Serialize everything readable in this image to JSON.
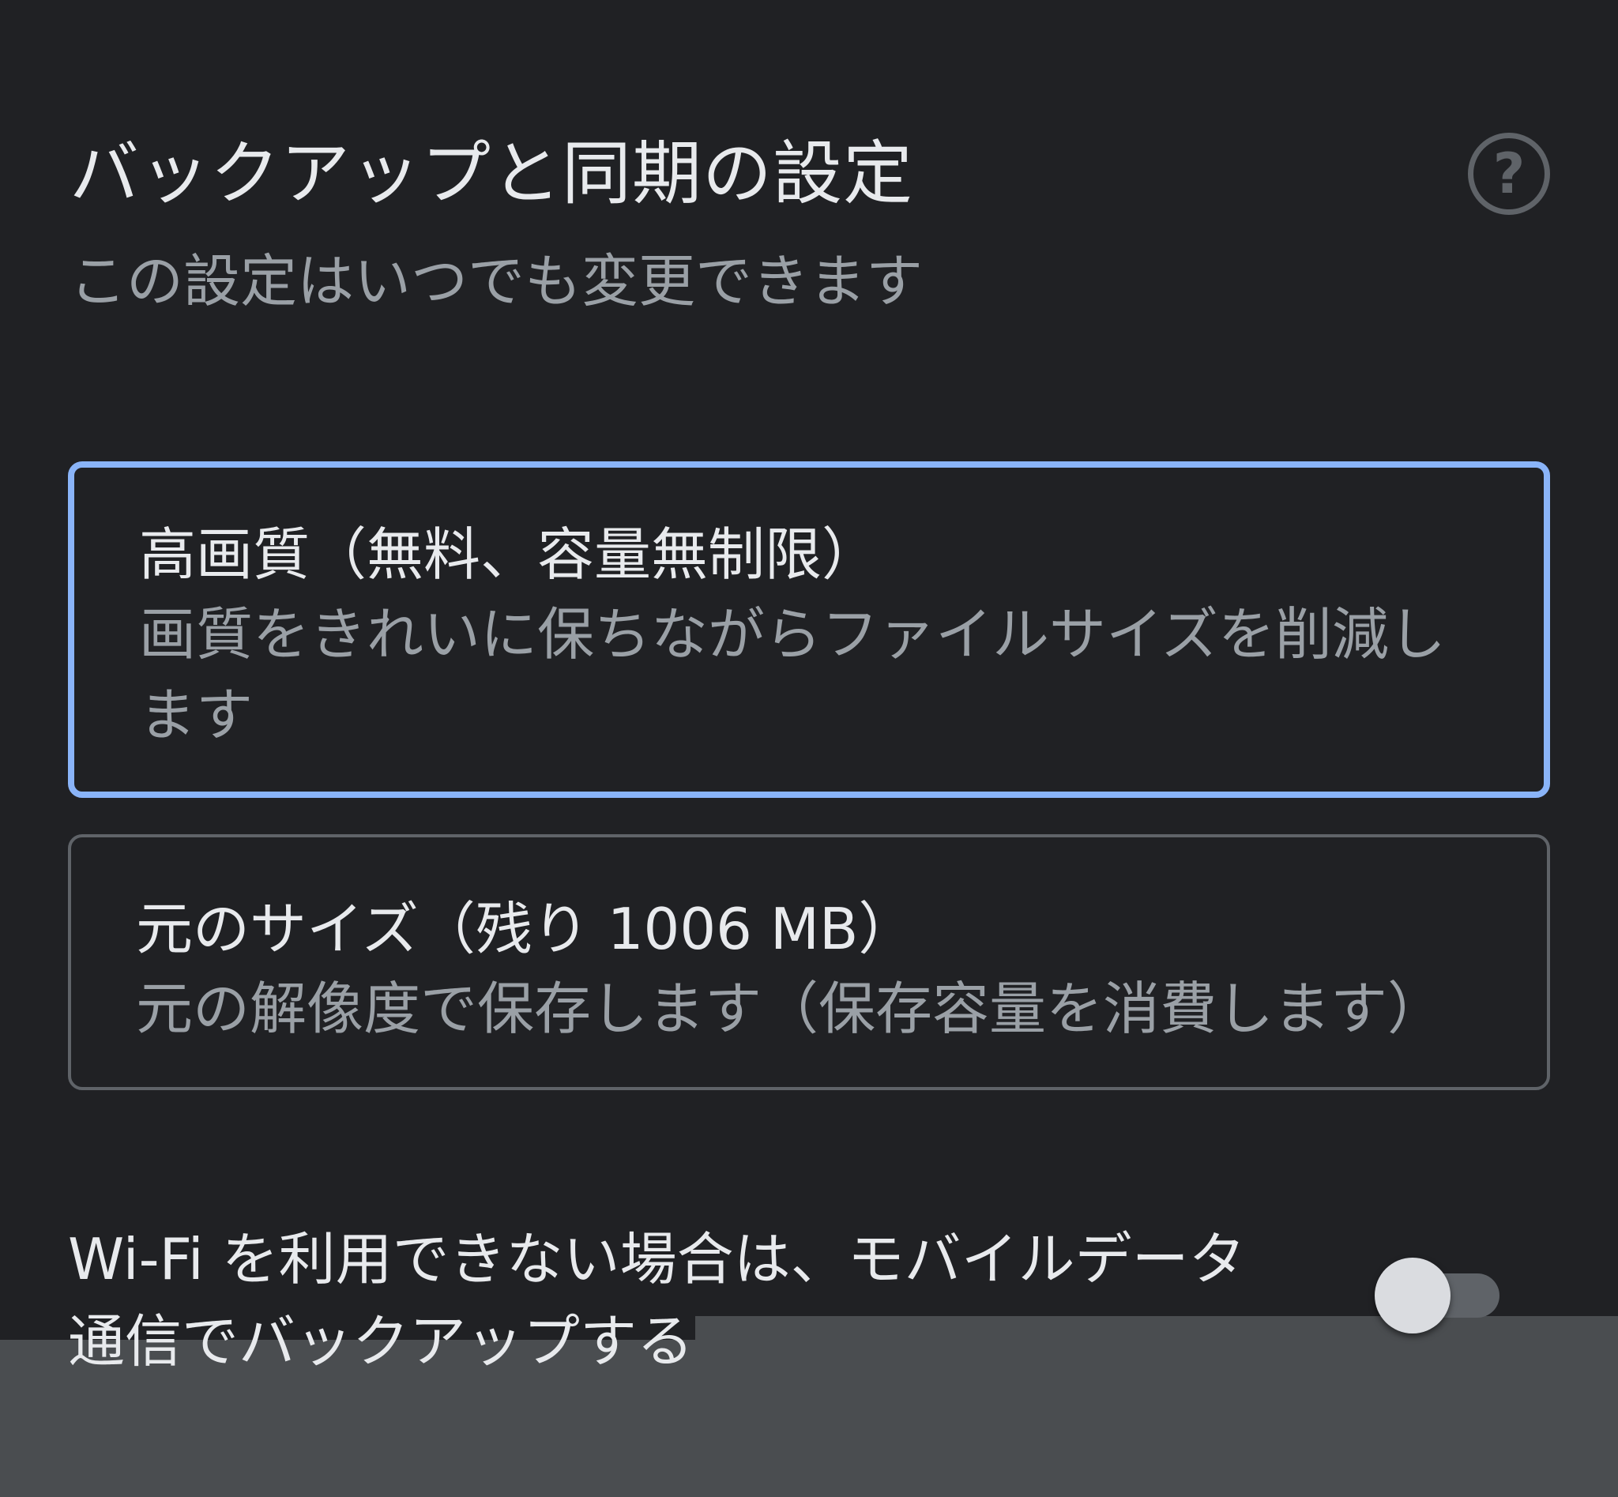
{
  "dialog": {
    "title": "バックアップと同期の設定",
    "subtitle": "この設定はいつでも変更できます",
    "help_icon": "help-circle-icon",
    "help_glyph": "?"
  },
  "options": [
    {
      "title": "高画質（無料、容量無制限）",
      "description": "画質をきれいに保ちながらファイルサイズを削減します",
      "selected": true
    },
    {
      "title": "元のサイズ（残り 1006 MB）",
      "description": "元の解像度で保存します（保存容量を消費します）",
      "selected": false
    }
  ],
  "mobile_data": {
    "label": "Wi-Fi を利用できない場合は、モバイルデータ通信でバックアップする",
    "enabled": false
  },
  "colors": {
    "background": "#202124",
    "selected_border": "#8ab4f8",
    "unselected_border": "#5f6368",
    "primary_text": "#e8eaed",
    "secondary_text": "#9aa0a6"
  }
}
